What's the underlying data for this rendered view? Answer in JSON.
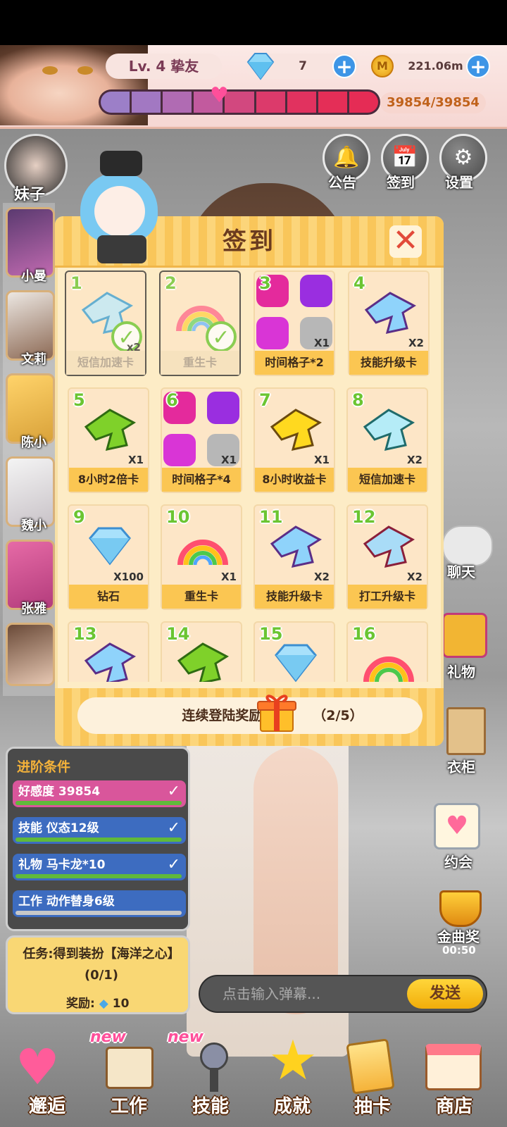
{
  "header": {
    "level_label": "Lv. 4 挚友",
    "gem_count": "7",
    "coin_amount": "221.06m",
    "affinity_value": "39854/39854"
  },
  "top_buttons": [
    {
      "label": "公告",
      "icon": "bell-icon"
    },
    {
      "label": "签到",
      "icon": "calendar-icon"
    },
    {
      "label": "设置",
      "icon": "gear-icon"
    }
  ],
  "characters": {
    "group_label": "妹子",
    "items": [
      "小曼",
      "文莉",
      "陈小",
      "魏小",
      "张雅",
      ""
    ]
  },
  "dialog": {
    "title": "签到",
    "days": [
      {
        "num": "1",
        "label": "短信加速卡",
        "count": "x2",
        "claimed": true
      },
      {
        "num": "2",
        "label": "重生卡",
        "count": "",
        "claimed": true
      },
      {
        "num": "3",
        "label": "时间格子*2",
        "count": "X1",
        "claimed": false
      },
      {
        "num": "4",
        "label": "技能升级卡",
        "count": "X2",
        "claimed": false
      },
      {
        "num": "5",
        "label": "8小时2倍卡",
        "count": "X1",
        "claimed": false
      },
      {
        "num": "6",
        "label": "时间格子*4",
        "count": "X1",
        "claimed": false
      },
      {
        "num": "7",
        "label": "8小时收益卡",
        "count": "X1",
        "claimed": false
      },
      {
        "num": "8",
        "label": "短信加速卡",
        "count": "X2",
        "claimed": false
      },
      {
        "num": "9",
        "label": "钻石",
        "count": "X100",
        "claimed": false
      },
      {
        "num": "10",
        "label": "重生卡",
        "count": "X1",
        "claimed": false
      },
      {
        "num": "11",
        "label": "技能升级卡",
        "count": "X2",
        "claimed": false
      },
      {
        "num": "12",
        "label": "打工升级卡",
        "count": "X2",
        "claimed": false
      },
      {
        "num": "13",
        "label": "",
        "count": "",
        "claimed": false
      },
      {
        "num": "14",
        "label": "",
        "count": "",
        "claimed": false
      },
      {
        "num": "15",
        "label": "",
        "count": "",
        "claimed": false
      },
      {
        "num": "16",
        "label": "",
        "count": "",
        "claimed": false
      }
    ],
    "streak_label": "连续登陆奖励:",
    "streak_progress": "（2/5）"
  },
  "conditions": {
    "title": "进阶条件",
    "items": [
      {
        "text": "好感度 39854",
        "done": true,
        "color": "#d9569b"
      },
      {
        "text": "技能 仪态12级",
        "done": true,
        "color": "#3d6cc0"
      },
      {
        "text": "礼物 马卡龙*10",
        "done": true,
        "color": "#3d6cc0"
      },
      {
        "text": "工作 动作替身6级",
        "done": false,
        "color": "#3d6cc0"
      }
    ]
  },
  "task": {
    "text": "任务:得到装扮【海洋之心】(0/1)",
    "reward_label": "奖励:",
    "reward_value": "10"
  },
  "side_buttons": [
    {
      "label": "聊天"
    },
    {
      "label": "礼物"
    },
    {
      "label": "衣柜"
    },
    {
      "label": "约会"
    },
    {
      "label": "金曲奖"
    }
  ],
  "countdown": "00:50",
  "bullet_chat": {
    "placeholder": "点击输入弹幕...",
    "send_label": "发送"
  },
  "nav": [
    {
      "label": "邂逅",
      "badge": ""
    },
    {
      "label": "工作",
      "badge": "new"
    },
    {
      "label": "技能",
      "badge": "new"
    },
    {
      "label": "成就",
      "badge": ""
    },
    {
      "label": "抽卡",
      "badge": ""
    },
    {
      "label": "商店",
      "badge": ""
    }
  ],
  "colors": {
    "accent_blue": "#3d95e6",
    "claimed_green": "#6bc532",
    "card_gold": "#fbc652"
  }
}
